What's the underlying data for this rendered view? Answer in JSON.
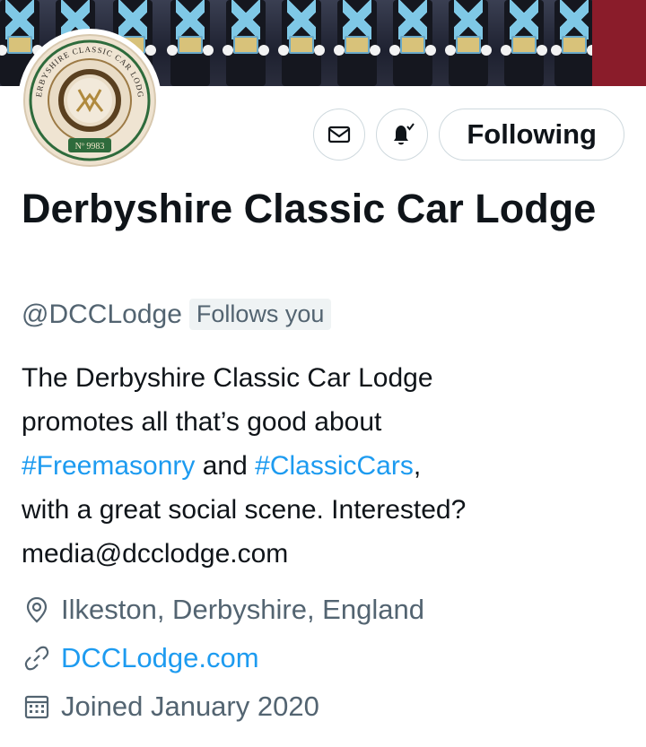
{
  "profile": {
    "display_name": "Derbyshire Classic Car Lodge",
    "handle": "@DCCLodge",
    "follows_you": "Follows you",
    "bio": {
      "line1": "The Derbyshire Classic Car Lodge",
      "line2": "promotes all that’s good about",
      "hashtag1": "#Freemasonry",
      "and": " and ",
      "hashtag2": "#ClassicCars",
      "comma": ",",
      "line4": "with a great social scene. Interested?",
      "line5": "media@dcclodge.com"
    },
    "location": "Ilkeston, Derbyshire, England",
    "website": "DCCLodge.com",
    "joined": "Joined January 2020"
  },
  "avatar_logo": {
    "arc_text": "DERBYSHIRE CLASSIC CAR LODGE",
    "number": "Nº 9983"
  },
  "actions": {
    "message_icon": "envelope-icon",
    "notify_icon": "bell-check-icon",
    "follow_label": "Following"
  },
  "colors": {
    "link": "#1d9bf0",
    "secondary_text": "#536471",
    "border": "#cfd9de"
  }
}
